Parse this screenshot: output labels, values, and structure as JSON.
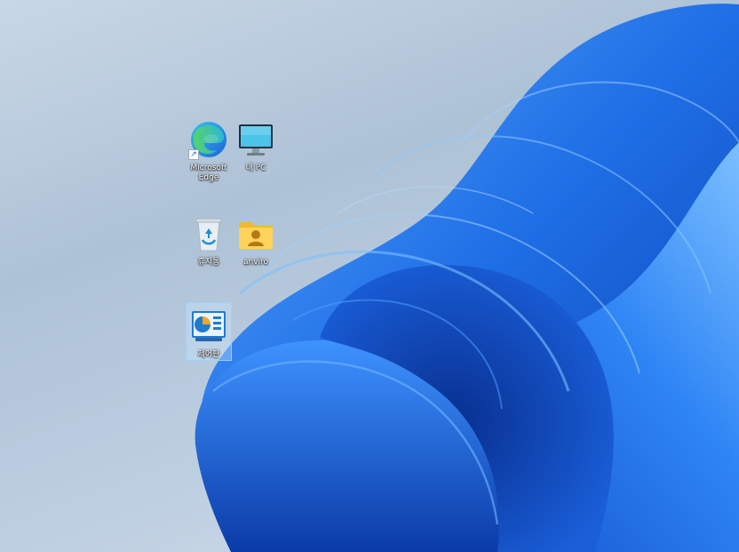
{
  "desktop": {
    "icons": [
      {
        "label": "Microsoft Edge",
        "icon": "edge-icon"
      },
      {
        "label": "내 PC",
        "icon": "monitor-icon"
      },
      {
        "label": "휴지통",
        "icon": "recycle-bin-icon"
      },
      {
        "label": "anviro",
        "icon": "user-folder-icon"
      },
      {
        "label": "제어판",
        "icon": "control-panel-icon"
      }
    ]
  },
  "colors": {
    "bloom_dark": "#0a3fb0",
    "bloom_mid": "#1f6fe6",
    "bloom_light": "#5aa7ff",
    "background": "#b9cadc"
  }
}
